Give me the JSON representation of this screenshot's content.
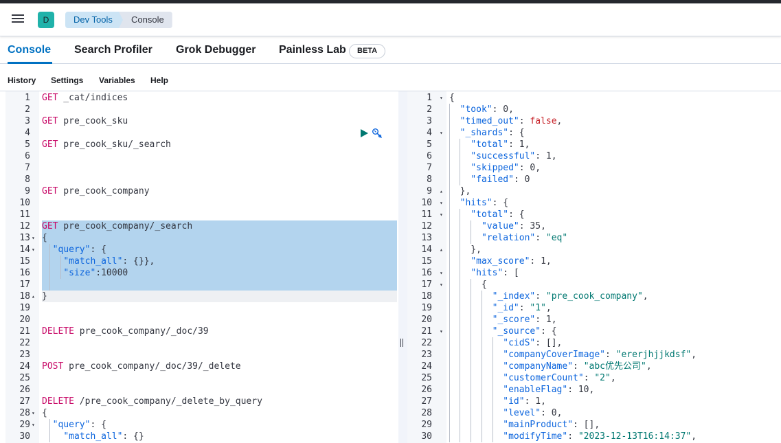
{
  "header": {
    "avatar_letter": "D",
    "breadcrumbs": [
      "Dev Tools",
      "Console"
    ]
  },
  "tabs": {
    "console": "Console",
    "search_profiler": "Search Profiler",
    "grok_debugger": "Grok Debugger",
    "painless_lab": "Painless Lab",
    "beta": "BETA"
  },
  "menu": {
    "history": "History",
    "settings": "Settings",
    "variables": "Variables",
    "help": "Help"
  },
  "editor": {
    "icons": [
      "play-icon",
      "wrench-icon"
    ],
    "lines": [
      [
        [
          "m",
          "GET"
        ],
        [
          "p",
          " _cat/indices"
        ]
      ],
      [],
      [
        [
          "m",
          "GET"
        ],
        [
          "p",
          " pre_cook_sku"
        ]
      ],
      [],
      [
        [
          "m",
          "GET"
        ],
        [
          "p",
          " pre_cook_sku/_search"
        ]
      ],
      [],
      [],
      [],
      [
        [
          "m",
          "GET"
        ],
        [
          "p",
          " pre_cook_company"
        ]
      ],
      [],
      [],
      [
        [
          "m",
          "GET"
        ],
        [
          "p",
          " pre_cook_company/_search"
        ]
      ],
      [
        [
          "p",
          "{"
        ]
      ],
      [
        [
          "p",
          "  "
        ],
        [
          "k",
          "\"query\""
        ],
        [
          "p",
          ": {"
        ]
      ],
      [
        [
          "p",
          "    "
        ],
        [
          "k",
          "\"match_all\""
        ],
        [
          "p",
          ": {}},"
        ]
      ],
      [
        [
          "p",
          "    "
        ],
        [
          "k",
          "\"size\""
        ],
        [
          "p",
          ":"
        ],
        [
          "n",
          "10000"
        ]
      ],
      [],
      [
        [
          "p",
          "}"
        ]
      ],
      [],
      [],
      [
        [
          "m",
          "DELETE"
        ],
        [
          "p",
          " pre_cook_company/_doc/39"
        ]
      ],
      [],
      [],
      [
        [
          "m",
          "POST"
        ],
        [
          "p",
          " pre_cook_company/_doc/39/_delete"
        ]
      ],
      [],
      [],
      [
        [
          "m",
          "DELETE"
        ],
        [
          "p",
          " /pre_cook_company/_delete_by_query"
        ]
      ],
      [
        [
          "p",
          "{"
        ]
      ],
      [
        [
          "p",
          "  "
        ],
        [
          "k",
          "\"query\""
        ],
        [
          "p",
          ": {"
        ]
      ],
      [
        [
          "p",
          "    "
        ],
        [
          "k",
          "\"match_all\""
        ],
        [
          "p",
          ": {}"
        ]
      ]
    ]
  },
  "output": {
    "lines": [
      [
        [
          "p",
          "{"
        ]
      ],
      [
        [
          "p",
          "  "
        ],
        [
          "k",
          "\"took\""
        ],
        [
          "p",
          ": "
        ],
        [
          "n",
          "0"
        ],
        [
          "p",
          ","
        ]
      ],
      [
        [
          "p",
          "  "
        ],
        [
          "k",
          "\"timed_out\""
        ],
        [
          "p",
          ": "
        ],
        [
          "b",
          "false"
        ],
        [
          "p",
          ","
        ]
      ],
      [
        [
          "p",
          "  "
        ],
        [
          "k",
          "\"_shards\""
        ],
        [
          "p",
          ": {"
        ]
      ],
      [
        [
          "p",
          "    "
        ],
        [
          "k",
          "\"total\""
        ],
        [
          "p",
          ": "
        ],
        [
          "n",
          "1"
        ],
        [
          "p",
          ","
        ]
      ],
      [
        [
          "p",
          "    "
        ],
        [
          "k",
          "\"successful\""
        ],
        [
          "p",
          ": "
        ],
        [
          "n",
          "1"
        ],
        [
          "p",
          ","
        ]
      ],
      [
        [
          "p",
          "    "
        ],
        [
          "k",
          "\"skipped\""
        ],
        [
          "p",
          ": "
        ],
        [
          "n",
          "0"
        ],
        [
          "p",
          ","
        ]
      ],
      [
        [
          "p",
          "    "
        ],
        [
          "k",
          "\"failed\""
        ],
        [
          "p",
          ": "
        ],
        [
          "n",
          "0"
        ]
      ],
      [
        [
          "p",
          "  },"
        ]
      ],
      [
        [
          "p",
          "  "
        ],
        [
          "k",
          "\"hits\""
        ],
        [
          "p",
          ": {"
        ]
      ],
      [
        [
          "p",
          "    "
        ],
        [
          "k",
          "\"total\""
        ],
        [
          "p",
          ": {"
        ]
      ],
      [
        [
          "p",
          "      "
        ],
        [
          "k",
          "\"value\""
        ],
        [
          "p",
          ": "
        ],
        [
          "n",
          "35"
        ],
        [
          "p",
          ","
        ]
      ],
      [
        [
          "p",
          "      "
        ],
        [
          "k",
          "\"relation\""
        ],
        [
          "p",
          ": "
        ],
        [
          "s",
          "\"eq\""
        ]
      ],
      [
        [
          "p",
          "    },"
        ]
      ],
      [
        [
          "p",
          "    "
        ],
        [
          "k",
          "\"max_score\""
        ],
        [
          "p",
          ": "
        ],
        [
          "n",
          "1"
        ],
        [
          "p",
          ","
        ]
      ],
      [
        [
          "p",
          "    "
        ],
        [
          "k",
          "\"hits\""
        ],
        [
          "p",
          ": ["
        ]
      ],
      [
        [
          "p",
          "      {"
        ]
      ],
      [
        [
          "p",
          "        "
        ],
        [
          "k",
          "\"_index\""
        ],
        [
          "p",
          ": "
        ],
        [
          "s",
          "\"pre_cook_company\""
        ],
        [
          "p",
          ","
        ]
      ],
      [
        [
          "p",
          "        "
        ],
        [
          "k",
          "\"_id\""
        ],
        [
          "p",
          ": "
        ],
        [
          "s",
          "\"1\""
        ],
        [
          "p",
          ","
        ]
      ],
      [
        [
          "p",
          "        "
        ],
        [
          "k",
          "\"_score\""
        ],
        [
          "p",
          ": "
        ],
        [
          "n",
          "1"
        ],
        [
          "p",
          ","
        ]
      ],
      [
        [
          "p",
          "        "
        ],
        [
          "k",
          "\"_source\""
        ],
        [
          "p",
          ": {"
        ]
      ],
      [
        [
          "p",
          "          "
        ],
        [
          "k",
          "\"cidS\""
        ],
        [
          "p",
          ": [],"
        ]
      ],
      [
        [
          "p",
          "          "
        ],
        [
          "k",
          "\"companyCoverImage\""
        ],
        [
          "p",
          ": "
        ],
        [
          "s",
          "\"ererjhjjkdsf\""
        ],
        [
          "p",
          ","
        ]
      ],
      [
        [
          "p",
          "          "
        ],
        [
          "k",
          "\"companyName\""
        ],
        [
          "p",
          ": "
        ],
        [
          "s",
          "\"abc优先公司\""
        ],
        [
          "p",
          ","
        ]
      ],
      [
        [
          "p",
          "          "
        ],
        [
          "k",
          "\"customerCount\""
        ],
        [
          "p",
          ": "
        ],
        [
          "s",
          "\"2\""
        ],
        [
          "p",
          ","
        ]
      ],
      [
        [
          "p",
          "          "
        ],
        [
          "k",
          "\"enableFlag\""
        ],
        [
          "p",
          ": "
        ],
        [
          "n",
          "10"
        ],
        [
          "p",
          ","
        ]
      ],
      [
        [
          "p",
          "          "
        ],
        [
          "k",
          "\"id\""
        ],
        [
          "p",
          ": "
        ],
        [
          "n",
          "1"
        ],
        [
          "p",
          ","
        ]
      ],
      [
        [
          "p",
          "          "
        ],
        [
          "k",
          "\"level\""
        ],
        [
          "p",
          ": "
        ],
        [
          "n",
          "0"
        ],
        [
          "p",
          ","
        ]
      ],
      [
        [
          "p",
          "          "
        ],
        [
          "k",
          "\"mainProduct\""
        ],
        [
          "p",
          ": [],"
        ]
      ],
      [
        [
          "p",
          "          "
        ],
        [
          "k",
          "\"modifyTime\""
        ],
        [
          "p",
          ": "
        ],
        [
          "s",
          "\"2023-12-13T16:14:37\""
        ],
        [
          "p",
          ","
        ]
      ]
    ]
  }
}
